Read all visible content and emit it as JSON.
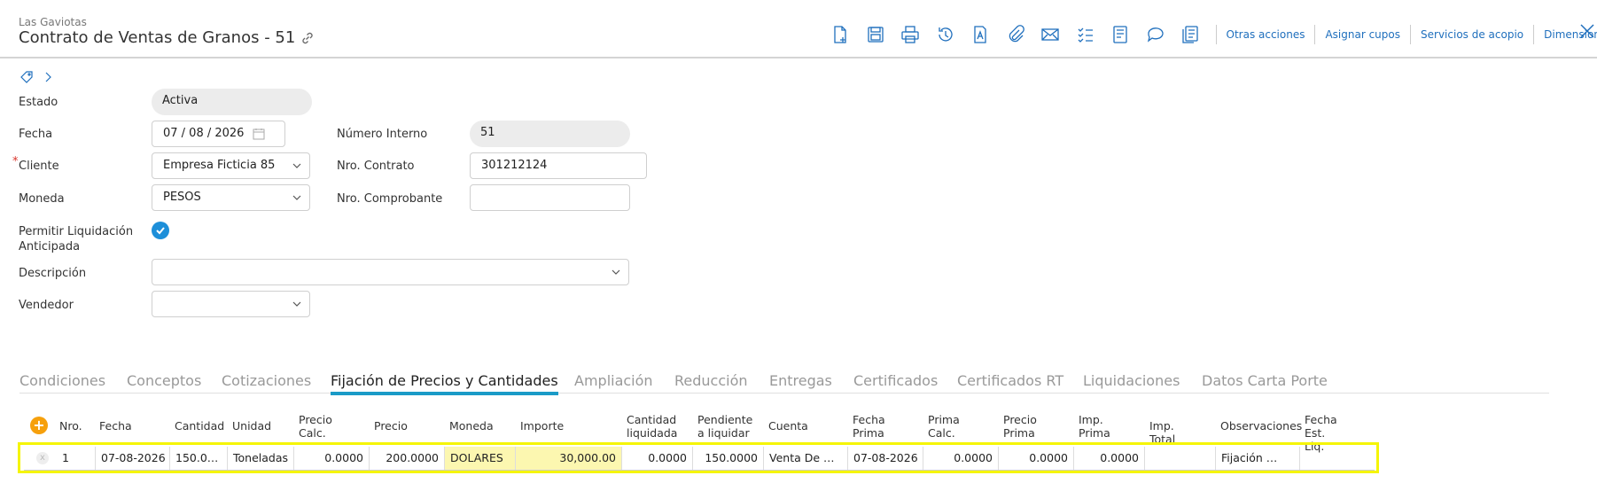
{
  "header": {
    "company": "Las Gaviotas",
    "title": "Contrato de Ventas de Granos - 51",
    "actions": [
      "Otras acciones",
      "Asignar cupos",
      "Servicios de acopio",
      "Dimensiones"
    ]
  },
  "form": {
    "estado": {
      "label": "Estado",
      "value": "Activa"
    },
    "fecha": {
      "label": "Fecha",
      "value": "07 / 08 / 2026"
    },
    "numero_interno": {
      "label": "Número Interno",
      "value": "51"
    },
    "cliente": {
      "label": "Cliente",
      "value": "Empresa Ficticia 85",
      "required_mark": "*"
    },
    "nro_contrato": {
      "label": "Nro. Contrato",
      "value": "301212124"
    },
    "moneda": {
      "label": "Moneda",
      "value": "PESOS"
    },
    "nro_comprobante": {
      "label": "Nro. Comprobante",
      "value": ""
    },
    "permitir": {
      "label_line1": "Permitir Liquidación",
      "label_line2": "Anticipada",
      "checked": true
    },
    "descripcion": {
      "label": "Descripción",
      "value": ""
    },
    "vendedor": {
      "label": "Vendedor",
      "value": ""
    }
  },
  "tabs": [
    "Condiciones",
    "Conceptos",
    "Cotizaciones",
    "Fijación de Precios y Cantidades",
    "Ampliación",
    "Reducción",
    "Entregas",
    "Certificados",
    "Certificados RT",
    "Liquidaciones",
    "Datos Carta Porte"
  ],
  "active_tab": "Fijación de Precios y Cantidades",
  "grid": {
    "add_label": "+",
    "columns": [
      {
        "l1": "Nro.",
        "l2": ""
      },
      {
        "l1": "Fecha",
        "l2": ""
      },
      {
        "l1": "Cantidad",
        "l2": ""
      },
      {
        "l1": "Unidad",
        "l2": ""
      },
      {
        "l1": "Precio",
        "l2": "Calc."
      },
      {
        "l1": "Precio",
        "l2": ""
      },
      {
        "l1": "Moneda",
        "l2": ""
      },
      {
        "l1": "Importe",
        "l2": ""
      },
      {
        "l1": "Cantidad",
        "l2": "liquidada"
      },
      {
        "l1": "Pendiente",
        "l2": "a liquidar"
      },
      {
        "l1": "Cuenta",
        "l2": ""
      },
      {
        "l1": "Fecha",
        "l2": "Prima"
      },
      {
        "l1": "Prima",
        "l2": "Calc."
      },
      {
        "l1": "Precio",
        "l2": "Prima"
      },
      {
        "l1": "Imp.",
        "l2": "Prima"
      },
      {
        "l1": "Imp. Total",
        "l2": ""
      },
      {
        "l1": "Observaciones",
        "l2": ""
      },
      {
        "l1": "Fecha",
        "l2": "Est. Liq."
      }
    ],
    "rows": [
      {
        "delete_label": "x",
        "cells": [
          "1",
          "07-08-2026",
          "150.0…",
          "Toneladas",
          "0.0000",
          "200.0000",
          "DOLARES",
          "30,000.00",
          "0.0000",
          "150.0000",
          "Venta De …",
          "07-08-2026",
          "0.0000",
          "0.0000",
          "0.0000",
          "",
          "Fijación …",
          ""
        ]
      }
    ]
  }
}
